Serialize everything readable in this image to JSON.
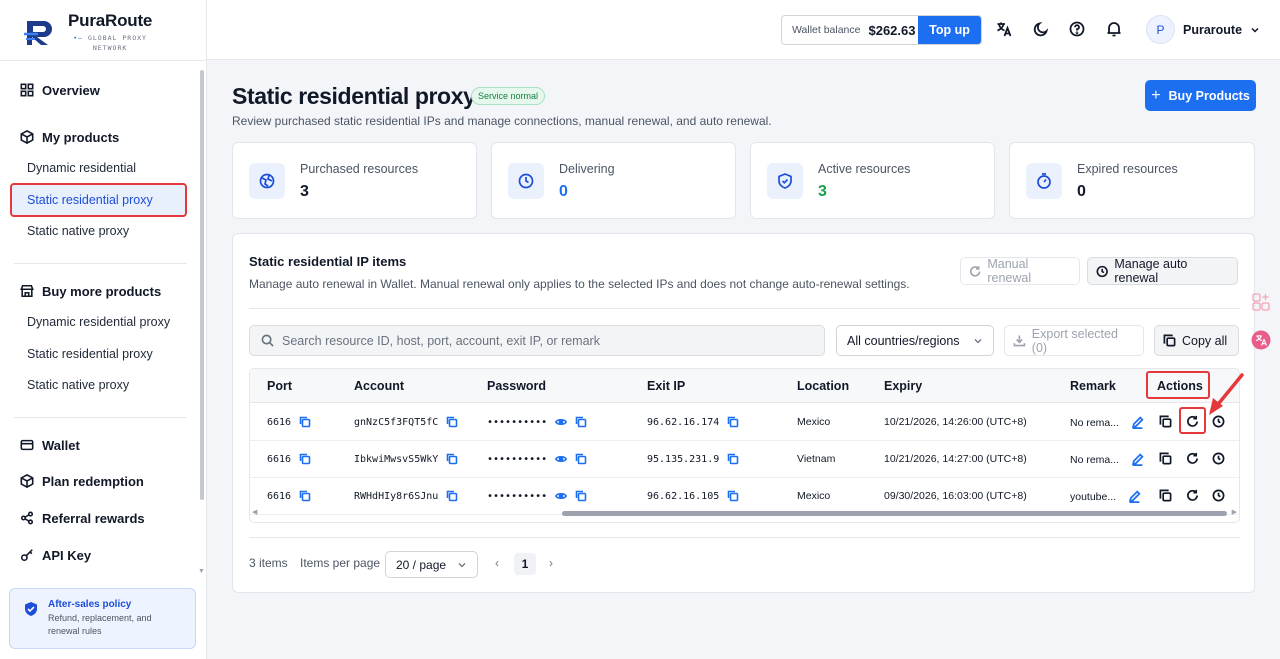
{
  "brand": {
    "name": "PuraRoute",
    "tagline_1": "GLOBAL PROXY",
    "tagline_2": "NETWORK"
  },
  "sidebar": {
    "overview": "Overview",
    "my_products": "My products",
    "my_products_items": [
      "Dynamic residential",
      "Static residential proxy",
      "Static native proxy"
    ],
    "buy_more": "Buy more products",
    "buy_more_items": [
      "Dynamic residential proxy",
      "Static residential proxy",
      "Static native proxy"
    ],
    "wallet": "Wallet",
    "plan_redemption": "Plan redemption",
    "referral_rewards": "Referral rewards",
    "api_key": "API Key",
    "policy": {
      "title": "After-sales policy",
      "desc": "Refund, replacement, and renewal rules"
    }
  },
  "header": {
    "wallet_label": "Wallet balance",
    "wallet_value": "$262.63",
    "topup_label": "Top up",
    "avatar_letter": "P",
    "user_name": "Puraroute"
  },
  "page": {
    "title": "Static residential proxy",
    "status": "Service normal",
    "subtitle": "Review purchased static residential IPs and manage connections, manual renewal, and auto renewal.",
    "buy_button": "Buy Products"
  },
  "stats": [
    {
      "label": "Purchased resources",
      "value": "3",
      "color": "#111827",
      "icon": "globe-icon"
    },
    {
      "label": "Delivering",
      "value": "0",
      "color": "#1d6ff2",
      "icon": "clock-icon"
    },
    {
      "label": "Active resources",
      "value": "3",
      "color": "#16a34a",
      "icon": "shield-icon"
    },
    {
      "label": "Expired resources",
      "value": "0",
      "color": "#111827",
      "icon": "timer-icon"
    }
  ],
  "panel": {
    "title": "Static residential IP items",
    "desc": "Manage auto renewal in Wallet. Manual renewal only applies to the selected IPs and does not change auto-renewal settings.",
    "manual_renewal": "Manual renewal",
    "manage_auto_renewal": "Manage auto renewal",
    "search_placeholder": "Search resource ID, host, port, account, exit IP, or remark",
    "country_select": "All countries/regions",
    "export_selected": "Export selected (0)",
    "copy_all": "Copy all"
  },
  "table": {
    "columns": [
      "Port",
      "Account",
      "Password",
      "Exit IP",
      "Location",
      "Expiry",
      "Remark",
      "Actions"
    ],
    "rows": [
      {
        "port": "6616",
        "account": "gnNzC5f3FQT5fC",
        "password": "••••••••••",
        "exit_ip": "96.62.16.174",
        "location": "Mexico",
        "expiry": "10/21/2026, 14:26:00 (UTC+8)",
        "remark": "No rema..."
      },
      {
        "port": "6616",
        "account": "IbkwiMwsvS5WkY",
        "password": "••••••••••",
        "exit_ip": "95.135.231.9",
        "location": "Vietnam",
        "expiry": "10/21/2026, 14:27:00 (UTC+8)",
        "remark": "No rema..."
      },
      {
        "port": "6616",
        "account": "RWHdHIy8r6SJnu",
        "password": "••••••••••",
        "exit_ip": "96.62.16.105",
        "location": "Mexico",
        "expiry": "09/30/2026, 16:03:00 (UTC+8)",
        "remark": "youtube..."
      }
    ]
  },
  "pagination": {
    "total": "3 items",
    "per_page_label": "Items per page",
    "per_page_value": "20 / page",
    "current_page": "1"
  },
  "colors": {
    "accent": "#1d6ff2",
    "highlight": "#e5383b",
    "success": "#16a34a"
  }
}
